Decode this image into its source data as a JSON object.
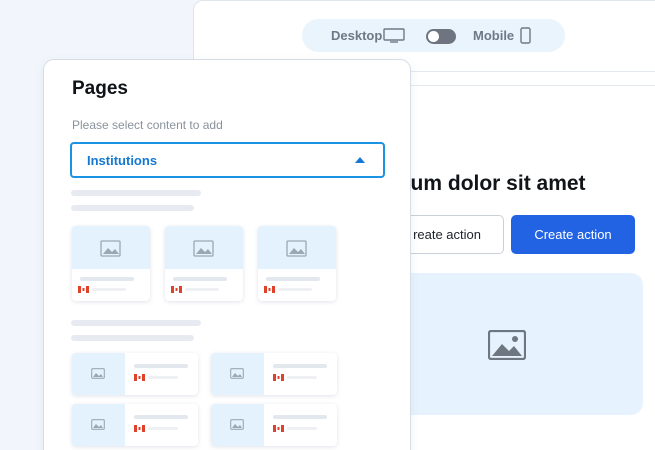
{
  "device_toggle": {
    "desktop_label": "Desktop",
    "mobile_label": "Mobile",
    "desktop_icon": "monitor-icon",
    "mobile_icon": "phone-icon"
  },
  "preview": {
    "title": "em ipsum dolor sit amet",
    "secondary_button": "reate action",
    "primary_button": "Create action",
    "media_icon": "image-icon"
  },
  "pages_panel": {
    "title": "Pages",
    "hint": "Please select content to add",
    "select_value": "Institutions"
  },
  "colors": {
    "accent": "#1a93e4",
    "primary_button": "#2263e4",
    "thumb_bg": "#e4f2fe",
    "flag_red": "#e0412b"
  }
}
